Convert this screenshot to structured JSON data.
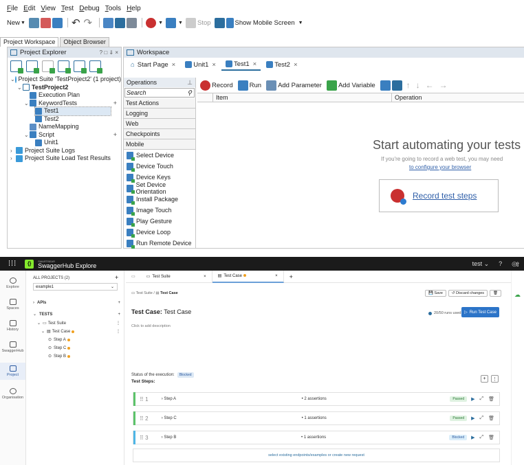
{
  "testcomplete": {
    "menu": [
      "File",
      "Edit",
      "View",
      "Test",
      "Debug",
      "Tools",
      "Help"
    ],
    "toolbar": {
      "new_label": "New",
      "stop_label": "Stop",
      "show_mobile_label": "Show Mobile Screen"
    },
    "workspace_tabs": [
      "Project Workspace",
      "Object Browser"
    ],
    "project_explorer": {
      "title": "Project Explorer",
      "controls": "? □ ⇓ ×",
      "tree": [
        {
          "label": "Project Suite 'TestProject2' (1 project)",
          "level": 0,
          "expanded": true
        },
        {
          "label": "TestProject2",
          "level": 1,
          "expanded": true,
          "bold": true
        },
        {
          "label": "Execution Plan",
          "level": 2
        },
        {
          "label": "KeywordTests",
          "level": 2,
          "expanded": true,
          "plus": true
        },
        {
          "label": "Test1",
          "level": 3,
          "selected": true
        },
        {
          "label": "Test2",
          "level": 3
        },
        {
          "label": "NameMapping",
          "level": 2
        },
        {
          "label": "Script",
          "level": 2,
          "expanded": true,
          "plus": true
        },
        {
          "label": "Unit1",
          "level": 3
        },
        {
          "label": "Project Suite Logs",
          "level": 0,
          "collapsed": true
        },
        {
          "label": "Project Suite Load Test Results",
          "level": 0,
          "collapsed": true
        }
      ]
    },
    "workspace": {
      "title": "Workspace",
      "tabs": [
        {
          "label": "Start Page",
          "closable": true
        },
        {
          "label": "Unit1",
          "closable": true
        },
        {
          "label": "Test1",
          "closable": true,
          "active": true
        },
        {
          "label": "Test2",
          "closable": true
        }
      ],
      "operations": {
        "title": "Operations",
        "search_placeholder": "Search",
        "categories": [
          "Test Actions",
          "Logging",
          "Web",
          "Checkpoints",
          "Mobile"
        ],
        "items": [
          "Select Device",
          "Device Touch",
          "Device Keys",
          "Set Device Orientation",
          "Install Package",
          "Image Touch",
          "Play Gesture",
          "Device Loop",
          "Run Remote Device"
        ]
      },
      "editor": {
        "record_label": "Record",
        "run_label": "Run",
        "add_parameter_label": "Add Parameter",
        "add_variable_label": "Add Variable",
        "columns": [
          "Item",
          "Operation"
        ],
        "start_title": "Start automating your tests",
        "start_subtitle": "If you're going to record a web test, you may need",
        "configure_link": "to configure your browser",
        "record_steps_label": "Record test steps"
      }
    }
  },
  "swaggerhub": {
    "brand_small": "SMARTBEAR",
    "brand": "SwaggerHub Explore",
    "user": "test",
    "rail": [
      "Explore",
      "Spaces",
      "History",
      "SwaggerHub",
      "Project",
      "Organisation"
    ],
    "panel": {
      "projects_label": "ALL PROJECTS (2)",
      "project_select": "example1",
      "apis_label": "APIs",
      "tests_label": "TESTS",
      "test_suite_label": "Test Suite",
      "test_case_label": "Test Case",
      "steps": [
        "Step A",
        "Step C",
        "Step B"
      ]
    },
    "tabs": [
      {
        "label": "Test Suite"
      },
      {
        "label": "Test Case",
        "active": true,
        "modified": true
      }
    ],
    "breadcrumb": [
      "Test Suite",
      "Test Case"
    ],
    "buttons": {
      "save": "Save",
      "discard": "Discard changes",
      "run_test_case": "Run Test Case"
    },
    "title_prefix": "Test Case:",
    "title": "Test Case",
    "runs_used": "20/50 runs used",
    "description_placeholder": "Click to add description",
    "status_label": "Status of the execution:",
    "status_value": "Blocked",
    "steps_title": "Test Steps:",
    "steps": [
      {
        "num": "1",
        "name": "Step A",
        "assertions": "2 assertions",
        "status": "Passed",
        "color": "#5cc36a"
      },
      {
        "num": "2",
        "name": "Step C",
        "assertions": "1 assertions",
        "status": "Passed",
        "color": "#5cc36a"
      },
      {
        "num": "3",
        "name": "Step B",
        "assertions": "1 assertions",
        "status": "Blocked",
        "color": "#4fb6e6"
      }
    ],
    "add_request_text": "select existing endpoints/examples or create new request"
  }
}
